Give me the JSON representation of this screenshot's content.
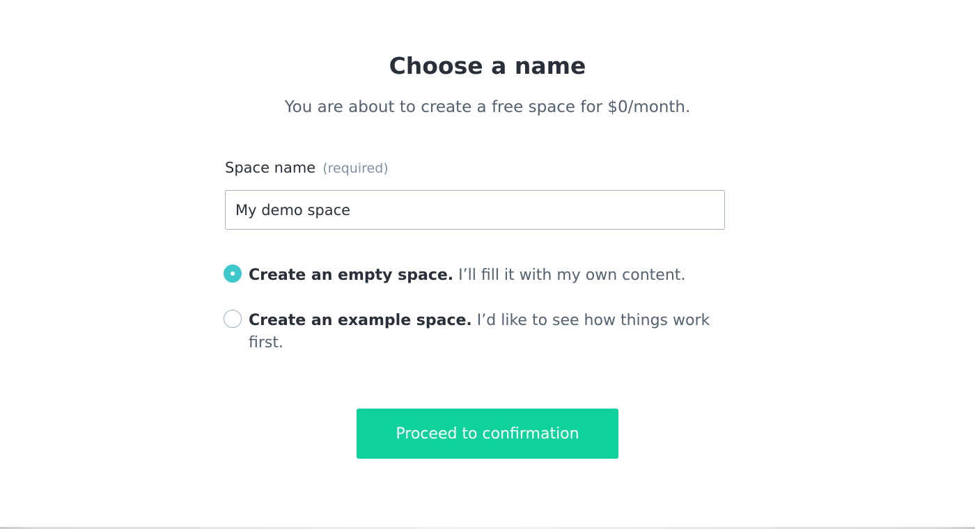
{
  "heading": {
    "title": "Choose a name",
    "subtitle": "You are about to create a free space for $0/month."
  },
  "form": {
    "space_name_label": "Space name",
    "required_hint": "(required)",
    "space_name_value": "My demo space"
  },
  "options": [
    {
      "title": "Create an empty space.",
      "description": "I’ll fill it with my own content.",
      "selected": true
    },
    {
      "title": "Create an example space.",
      "description": "I’d like to see how things work first.",
      "selected": false
    }
  ],
  "actions": {
    "proceed_label": "Proceed to confirmation"
  },
  "colors": {
    "accent": "#0fd19d",
    "radio_selected": "#3ec8cc",
    "heading_text": "#2a3039",
    "muted_text": "#536171"
  }
}
